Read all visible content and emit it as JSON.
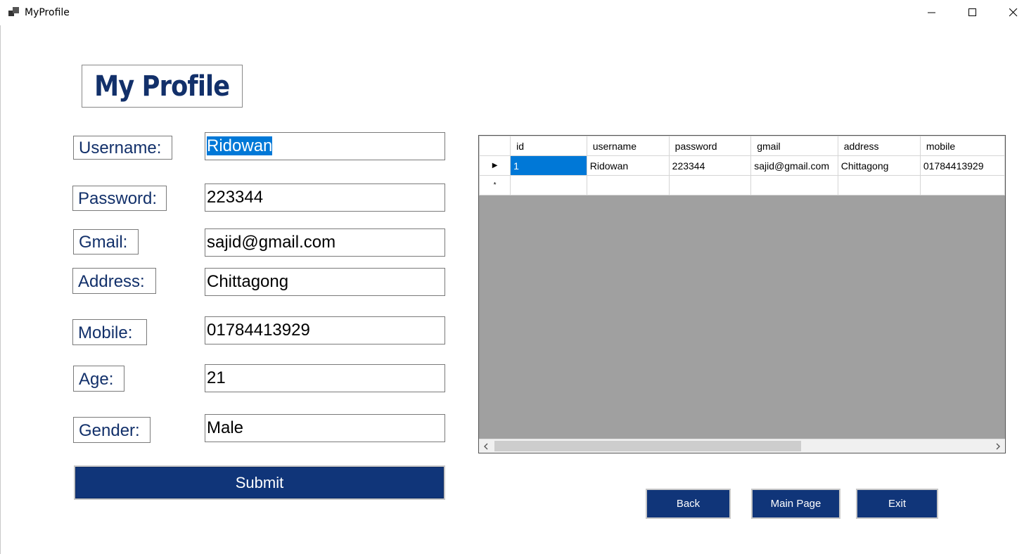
{
  "window": {
    "title": "MyProfile",
    "controls": [
      "minimize-icon",
      "maximize-icon",
      "close-icon"
    ]
  },
  "heading": "My Profile",
  "form": {
    "username": {
      "label": "Username:",
      "value": "Ridowan"
    },
    "password": {
      "label": "Password:",
      "value": "223344"
    },
    "gmail": {
      "label": "Gmail:",
      "value": "sajid@gmail.com"
    },
    "address": {
      "label": "Address:",
      "value": "Chittagong"
    },
    "mobile": {
      "label": "Mobile:",
      "value": "01784413929"
    },
    "age": {
      "label": "Age:",
      "value": "21"
    },
    "gender": {
      "label": "Gender:",
      "value": "Male"
    }
  },
  "submit_label": "Submit",
  "grid": {
    "columns": [
      "id",
      "username",
      "password",
      "gmail",
      "address",
      "mobile"
    ],
    "rows": [
      [
        "1",
        "Ridowan",
        "223344",
        "sajid@gmail.com",
        "Chittagong",
        "01784413929"
      ]
    ],
    "row_indicators": {
      "current": "▶",
      "new": "*"
    }
  },
  "buttons": {
    "back": "Back",
    "main_page": "Main Page",
    "exit": "Exit"
  },
  "colors": {
    "accent": "#103579",
    "label_text": "#12306a",
    "selection": "#0078d7",
    "grid_background": "#a0a0a0"
  }
}
